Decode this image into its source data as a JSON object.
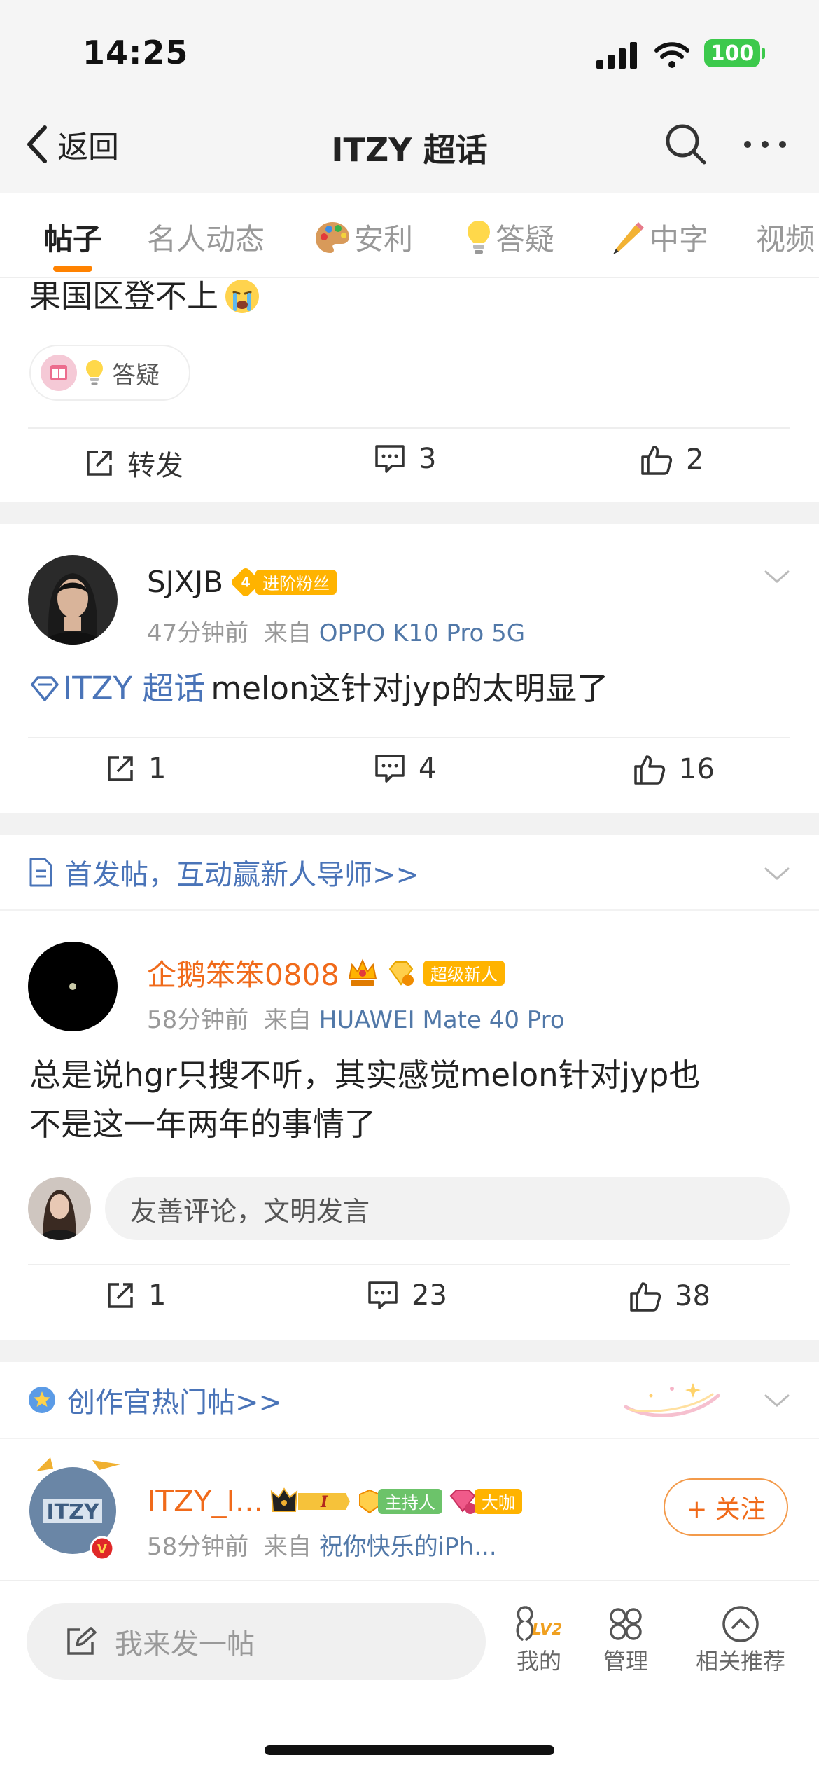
{
  "status_bar": {
    "time": "14:25",
    "battery": "100"
  },
  "nav": {
    "back_label": "返回",
    "title": "ITZY 超话"
  },
  "tabs": [
    {
      "label": "帖子",
      "icon": ""
    },
    {
      "label": "名人动态",
      "icon": ""
    },
    {
      "label": "安利",
      "icon": "palette-icon"
    },
    {
      "label": "答疑",
      "icon": "bulb-icon"
    },
    {
      "label": "中字",
      "icon": "pencil-icon"
    },
    {
      "label": "视频",
      "icon": ""
    }
  ],
  "post1": {
    "text_tail": "果国区登不上",
    "emoji": "crying-face-icon",
    "tag_label": "答疑",
    "repost_label": "转发",
    "comments": "3",
    "likes": "2"
  },
  "post2": {
    "username": "SJXJB",
    "badge_level": "4",
    "badge_label": "进阶粉丝",
    "time": "47分钟前",
    "from": "来自",
    "source": "OPPO K10 Pro 5G",
    "topic": "ITZY 超话",
    "text": "melon这针对jyp的太明显了",
    "reposts": "1",
    "comments": "4",
    "likes": "16"
  },
  "banner1": {
    "text": "首发帖，互动赢新人导师>>"
  },
  "post3": {
    "username": "企鹅笨笨0808",
    "badge_label": "超级新人",
    "time": "58分钟前",
    "from": "来自",
    "source": "HUAWEI Mate 40 Pro",
    "text_line1": "总是说hgr只搜不听，其实感觉melon针对jyp也",
    "text_line2": "不是这一年两年的事情了",
    "comment_placeholder": "友善评论，文明发言",
    "reposts": "1",
    "comments": "23",
    "likes": "38"
  },
  "banner2": {
    "text": "创作官热门帖>>"
  },
  "post4": {
    "username": "ITZY_I...",
    "badge_host": "主持人",
    "badge_coffee": "大咖",
    "time": "58分钟前",
    "from": "来自",
    "source": "祝你快乐的iPh...",
    "follow_label": "+ 关注"
  },
  "bottom": {
    "compose_placeholder": "我来发一帖",
    "mine_label": "我的",
    "mine_level": "LV2",
    "manage_label": "管理",
    "related_label": "相关推荐"
  },
  "colors": {
    "accent": "#ff8200",
    "link": "#4a74b8",
    "battery": "#3cc94c"
  }
}
